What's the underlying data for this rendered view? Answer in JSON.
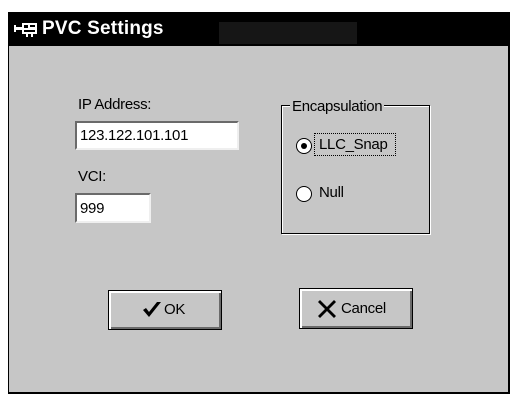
{
  "window": {
    "title": "PVC Settings",
    "icon": "network-card-icon"
  },
  "form": {
    "ip_label": "IP Address:",
    "ip_value": "123.122.101.101",
    "vci_label": "VCI:",
    "vci_value": "999"
  },
  "encapsulation": {
    "legend": "Encapsulation",
    "options": [
      {
        "label": "LLC_Snap",
        "selected": true
      },
      {
        "label": "Null",
        "selected": false
      }
    ]
  },
  "buttons": {
    "ok_label": "OK",
    "ok_icon": "checkmark-icon",
    "cancel_label": "Cancel",
    "cancel_icon": "cross-icon"
  }
}
